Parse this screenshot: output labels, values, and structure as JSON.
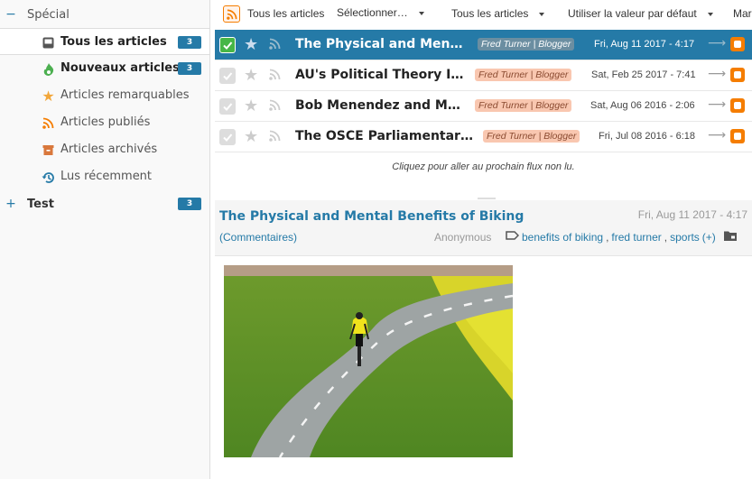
{
  "sidebar": {
    "categories": [
      {
        "toggle": "−",
        "title": "Spécial"
      },
      {
        "toggle": "+",
        "title": "Test",
        "count": "3"
      }
    ],
    "feeds": [
      {
        "title": "Tous les articles",
        "icon": "inbox-icon",
        "count": "3"
      },
      {
        "title": "Nouveaux articles",
        "icon": "fresh-icon",
        "count": "3"
      },
      {
        "title": "Articles remarquables",
        "icon": "star-icon"
      },
      {
        "title": "Articles publiés",
        "icon": "rss-icon"
      },
      {
        "title": "Articles archivés",
        "icon": "archive-icon"
      },
      {
        "title": "Lus récemment",
        "icon": "history-icon"
      }
    ]
  },
  "toolbar": {
    "feed_title": "Tous les articles",
    "select_label": "Sélectionner…",
    "view_mode": "Tous les articles",
    "sort_mode": "Utiliser la valeur par défaut",
    "mark_label": "Mar"
  },
  "headlines": [
    {
      "title": "The Physical and Mental Benefits of Biking",
      "feed": "Fred Turner | Blogger",
      "date": "Fri, Aug 11 2017 - 4:17"
    },
    {
      "title": "AU's Political Theory Institute",
      "feed": "Fred Turner | Blogger",
      "date": "Sat, Feb 25 2017 - 7:41"
    },
    {
      "title": "Bob Menendez and Max Sandlin",
      "feed": "Fred Turner | Blogger",
      "date": "Sat, Aug 06 2016 - 2:06"
    },
    {
      "title": "The OSCE Parliamentary Assembly",
      "feed": "Fred Turner | Blogger",
      "date": "Fri, Jul 08 2016 - 6:18"
    }
  ],
  "next_feed_hint": "Cliquez pour aller au prochain flux non lu.",
  "article": {
    "title": "The Physical and Mental Benefits of Biking",
    "date": "Fri, Aug 11 2017 - 4:17",
    "comments": "(Commentaires)",
    "author": "Anonymous",
    "tags": [
      "benefits of biking",
      "fred turner",
      "sports"
    ],
    "tags_more": "(+)"
  },
  "colors": {
    "accent": "#257aa7",
    "feed_tag": "#f9c7b0",
    "blogger": "#f57d00",
    "checked": "#47b647"
  }
}
